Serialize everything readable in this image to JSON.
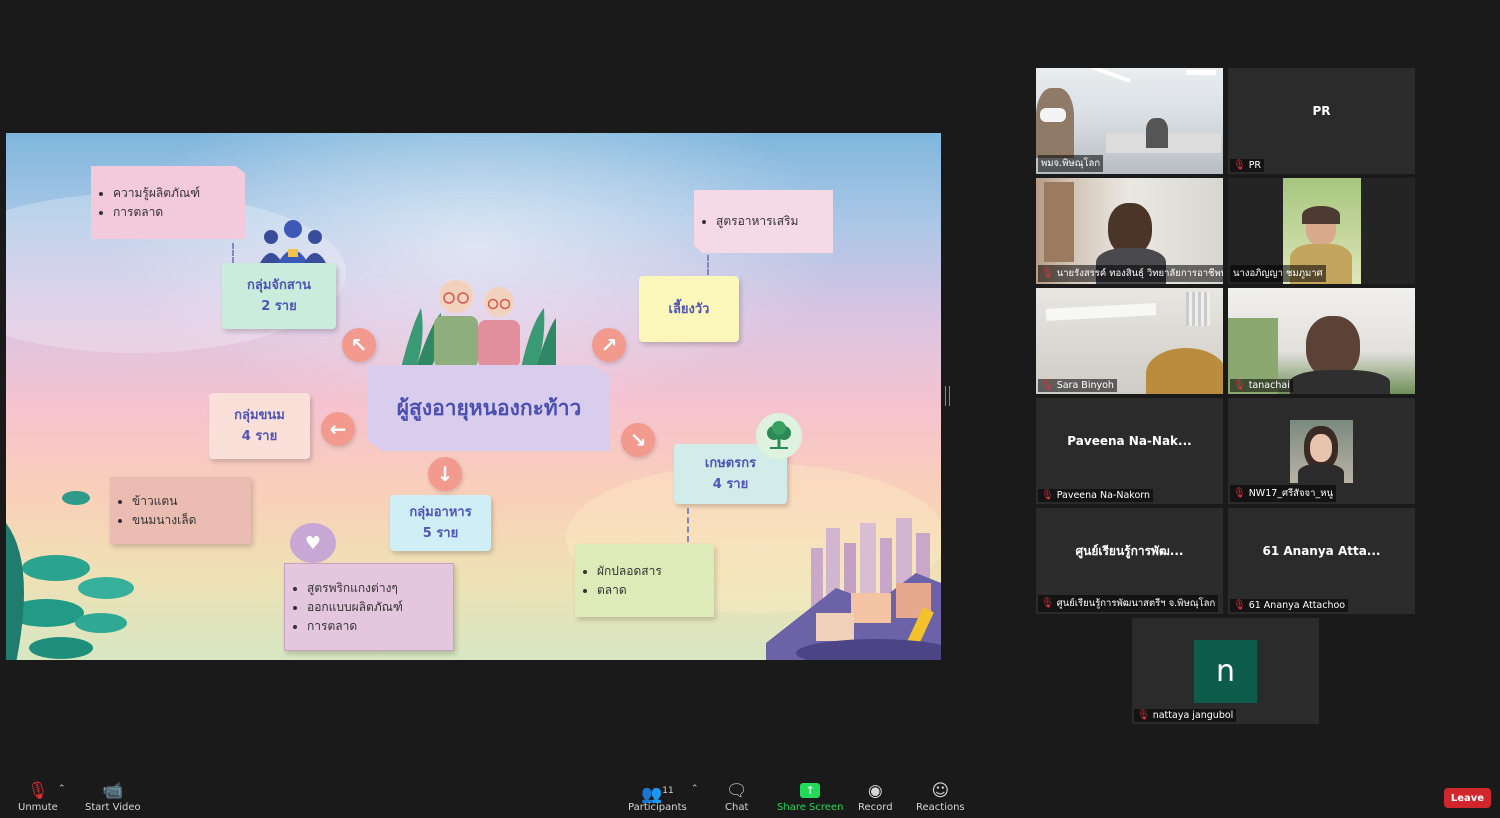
{
  "slide": {
    "center_title": "ผู้สูงอายุหนองกะท้าว",
    "groups": {
      "weaving": {
        "name": "กลุ่มจักสาน",
        "count": "2 ราย"
      },
      "cattle": {
        "name": "เลี้ยงวัว"
      },
      "dessert": {
        "name": "กลุ่มขนม",
        "count": "4 ราย"
      },
      "farmer": {
        "name": "เกษตรกร",
        "count": "4 ราย"
      },
      "food": {
        "name": "กลุ่มอาหาร",
        "count": "5 ราย"
      }
    },
    "notes": {
      "weaving": [
        "ความรู้ผลิตภัณฑ์",
        "การตลาด"
      ],
      "cattle": [
        "สูตรอาหารเสริม"
      ],
      "dessert": [
        "ข้าวแตน",
        "ขนมนางเล็ด"
      ],
      "food": [
        "สูตรพริกแกงต่างๆ",
        "ออกแบบผลิตภัณฑ์",
        "การตลาด"
      ],
      "farmer": [
        "ผักปลอดสาร",
        "ตลาด"
      ]
    }
  },
  "participants": [
    {
      "name": "พมจ.พิษณุโลก",
      "video": true,
      "muted": false
    },
    {
      "name": "PR",
      "display": "PR",
      "video": false,
      "muted": true
    },
    {
      "name": "นายรังสรรค์ ทองสินธุ์ วิทยาลัยการอาชีพพ...",
      "video": true,
      "muted": true
    },
    {
      "name": "นางอภิญญา ชมภูมาศ",
      "video": true,
      "muted": false,
      "active": true
    },
    {
      "name": "Sara Binyoh",
      "video": true,
      "muted": true
    },
    {
      "name": "tanachai",
      "video": true,
      "muted": true
    },
    {
      "name": "Paveena Na-Nakorn",
      "display": "Paveena  Na-Nak...",
      "video": false,
      "muted": true
    },
    {
      "name": "NW17_ศรีสัจจา_หนู",
      "video": false,
      "muted": true,
      "photo": true
    },
    {
      "name": "ศูนย์เรียนรู้การพัฒนาสตรีฯ จ.พิษณุโลก",
      "display": "ศูนย์เรียนรู้การพัฒ...",
      "video": false,
      "muted": true
    },
    {
      "name": "61 Ananya  Attachoo",
      "display": "61 Ananya   Atta...",
      "video": false,
      "muted": true
    },
    {
      "name": "nattaya jangubol",
      "initial": "n",
      "video": false,
      "muted": true
    }
  ],
  "toolbar": {
    "unmute": "Unmute",
    "start_video": "Start Video",
    "participants": "Participants",
    "participants_count": "11",
    "chat": "Chat",
    "share_screen": "Share Screen",
    "record": "Record",
    "reactions": "Reactions",
    "leave": "Leave"
  },
  "colors": {
    "accent_green": "#23d959",
    "leave_red": "#d0262c",
    "active_speaker": "#d8e28a",
    "avatar_bg": "#0e5c4c"
  },
  "icons": [
    "mic-off-icon",
    "video-off-icon",
    "participants-icon",
    "chat-icon",
    "share-screen-icon",
    "record-icon",
    "reactions-icon",
    "chevron-up-icon"
  ]
}
